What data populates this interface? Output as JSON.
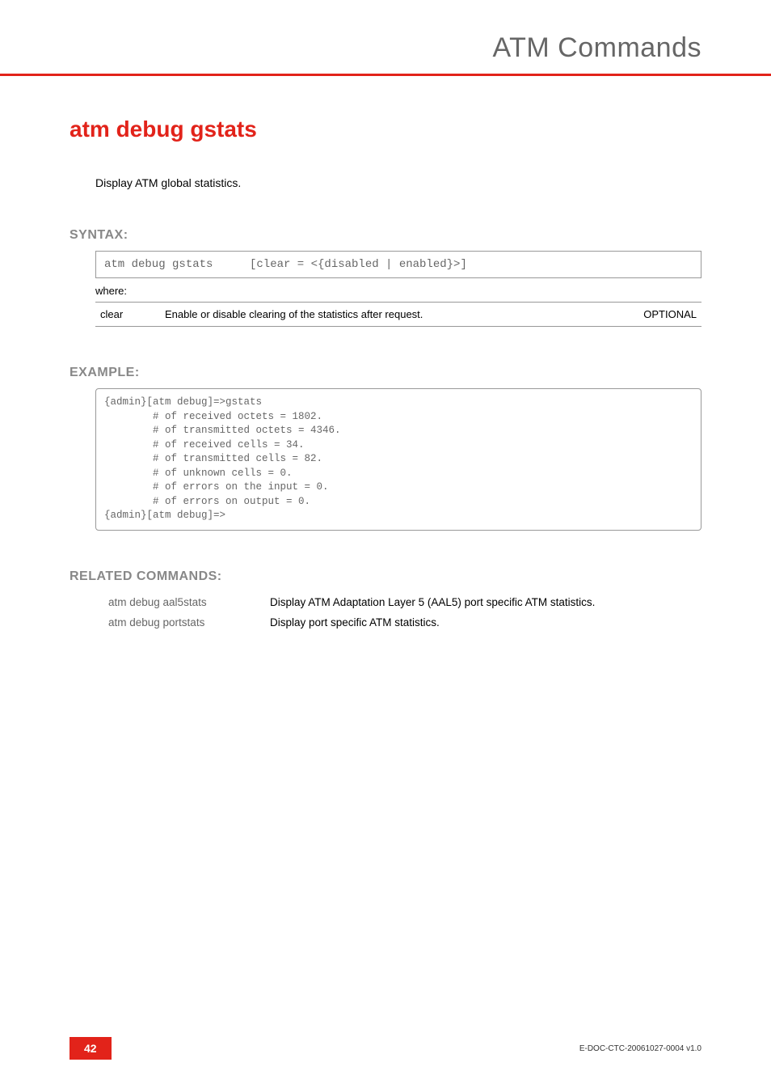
{
  "header": {
    "title": "ATM Commands"
  },
  "command": {
    "title": "atm debug gstats",
    "description": "Display ATM global statistics."
  },
  "syntax": {
    "heading": "SYNTAX:",
    "cmd": "atm debug gstats",
    "args": "[clear = <{disabled | enabled}>]",
    "where_label": "where:",
    "params": [
      {
        "name": "clear",
        "desc": "Enable or disable clearing of the statistics after request.",
        "opt": "OPTIONAL"
      }
    ]
  },
  "example": {
    "heading": "EXAMPLE:",
    "text": "{admin}[atm debug]=>gstats\n        # of received octets = 1802.\n        # of transmitted octets = 4346.\n        # of received cells = 34.\n        # of transmitted cells = 82.\n        # of unknown cells = 0.\n        # of errors on the input = 0.\n        # of errors on output = 0.\n{admin}[atm debug]=>"
  },
  "related": {
    "heading": "RELATED COMMANDS:",
    "rows": [
      {
        "cmd": "atm debug aal5stats",
        "desc": "Display ATM Adaptation Layer 5 (AAL5) port specific ATM statistics."
      },
      {
        "cmd": "atm debug portstats",
        "desc": "Display port specific ATM statistics."
      }
    ]
  },
  "footer": {
    "page": "42",
    "docid": "E-DOC-CTC-20061027-0004 v1.0"
  }
}
